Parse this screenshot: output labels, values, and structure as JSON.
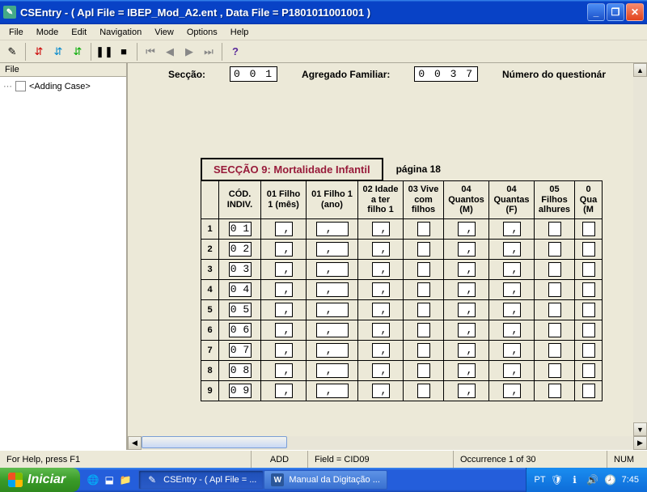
{
  "window": {
    "title": "CSEntry - ( Apl File = IBEP_Mod_A2.ent , Data File = P1801011001001 )"
  },
  "menu": [
    "File",
    "Mode",
    "Edit",
    "Navigation",
    "View",
    "Options",
    "Help"
  ],
  "sidebar": {
    "header": "File",
    "item": "<Adding Case>"
  },
  "top": {
    "seccao_label": "Secção:",
    "seccao_value": "0 0 1",
    "agregado_label": "Agregado Familiar:",
    "agregado_value": "0 0 3 7",
    "numero_label": "Número do questionár"
  },
  "section": {
    "title": "SECÇÃO 9: Mortalidade Infantil",
    "page": "página 18"
  },
  "columns": [
    "CÓD. INDIV.",
    "01 Filho 1 (mês)",
    "01 Filho 1 (ano)",
    "02 Idade a ter filho 1",
    "03 Vive com filhos",
    "04 Quantos (M)",
    "04 Quantas (F)",
    "05 Filhos alhures",
    "0 Qua (M"
  ],
  "rows": [
    {
      "n": "1",
      "cod": "0 1"
    },
    {
      "n": "2",
      "cod": "0 2"
    },
    {
      "n": "3",
      "cod": "0 3"
    },
    {
      "n": "4",
      "cod": "0 4"
    },
    {
      "n": "5",
      "cod": "0 5"
    },
    {
      "n": "6",
      "cod": "0 6"
    },
    {
      "n": "7",
      "cod": "0 7"
    },
    {
      "n": "8",
      "cod": "0 8"
    },
    {
      "n": "9",
      "cod": "0 9"
    }
  ],
  "status": {
    "help": "For Help, press F1",
    "mode": "ADD",
    "field": "Field = CID09",
    "occ": "Occurrence 1 of 30",
    "num": "NUM"
  },
  "taskbar": {
    "start": "Iniciar",
    "task1": "CSEntry - ( Apl File = ...",
    "task2": "Manual da Digitação ...",
    "lang": "PT",
    "clock": "7:45"
  }
}
